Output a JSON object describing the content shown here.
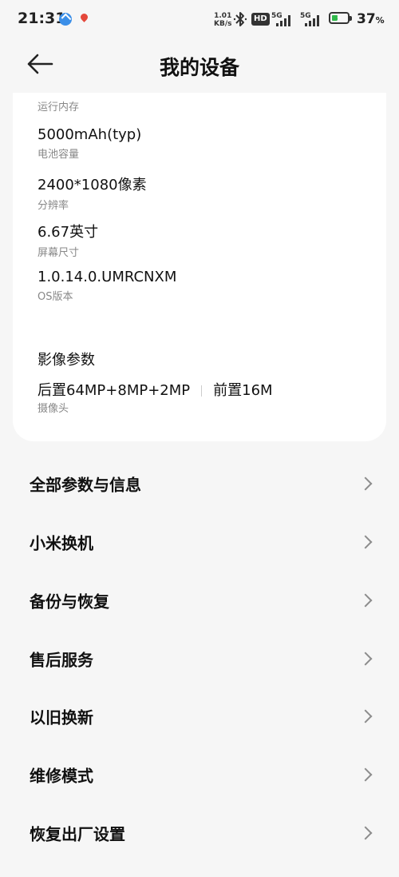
{
  "status_bar": {
    "time": "21:31",
    "net_speed_value": "1.01",
    "net_speed_unit": "KB/s",
    "hd_badge": "HD",
    "signal_1_label": "5G",
    "signal_2_label": "5G",
    "battery_percent": "37",
    "battery_percent_unit": "%",
    "battery_level": 0.37,
    "icons": [
      "app-notification-icon",
      "location-pin-icon",
      "bluetooth-icon",
      "signal-icon",
      "battery-charging-icon"
    ],
    "colors": {
      "battery_fill": "#2fb84a",
      "app_icon": "#3b8fe8",
      "pin": "#e4473a"
    }
  },
  "header": {
    "title": "我的设备",
    "back_icon": "arrow-left-icon"
  },
  "specs": {
    "partial_label": "运行内存",
    "items": [
      {
        "value": "5000mAh(typ)",
        "label": "电池容量"
      },
      {
        "value": "2400*1080像素",
        "label": "分辨率"
      },
      {
        "value": "6.67英寸",
        "label": "屏幕尺寸"
      },
      {
        "value": "1.0.14.0.UMRCNXM",
        "label": "OS版本"
      }
    ],
    "camera_section_title": "影像参数",
    "camera_rear": "后置64MP+8MP+2MP",
    "camera_front": "前置16M",
    "camera_label": "摄像头"
  },
  "menu": {
    "items": [
      {
        "label": "全部参数与信息"
      },
      {
        "label": "小米换机"
      },
      {
        "label": "备份与恢复"
      },
      {
        "label": "售后服务"
      },
      {
        "label": "以旧换新"
      },
      {
        "label": "维修模式"
      },
      {
        "label": "恢复出厂设置"
      }
    ]
  }
}
